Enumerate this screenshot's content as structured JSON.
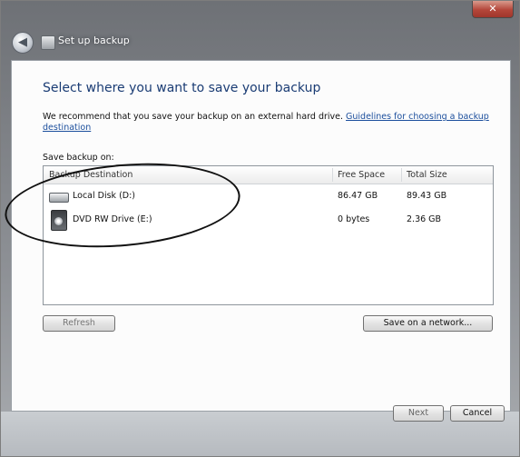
{
  "window": {
    "title": "Set up backup",
    "close_label": "✕",
    "back_label": "◀"
  },
  "content": {
    "heading": "Select where you want to save your backup",
    "recommend_text": "We recommend that you save your backup on an external hard drive. ",
    "guidelines_link": "Guidelines for choosing a backup destination",
    "save_label": "Save backup on:"
  },
  "list": {
    "columns": [
      "Backup Destination",
      "Free Space",
      "Total Size"
    ],
    "rows": [
      {
        "name": "Local Disk (D:)",
        "free": "86.47 GB",
        "total": "89.43 GB",
        "icon": "hard-disk-icon"
      },
      {
        "name": "DVD RW Drive (E:)",
        "free": "0 bytes",
        "total": "2.36 GB",
        "icon": "dvd-drive-icon"
      }
    ]
  },
  "buttons": {
    "refresh": "Refresh",
    "save_network": "Save on a network...",
    "next": "Next",
    "cancel": "Cancel"
  },
  "colors": {
    "heading": "#1a3c74",
    "link": "#1b4e9c",
    "annotation": "#111111"
  }
}
